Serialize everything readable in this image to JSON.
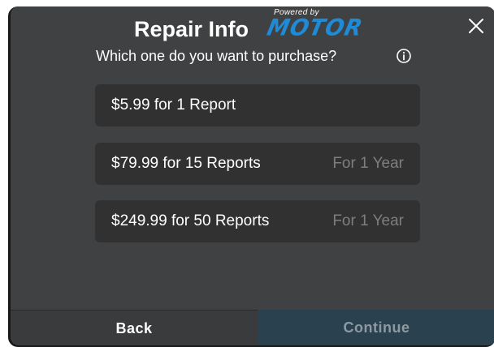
{
  "dialog": {
    "title": "Repair Info",
    "logo": {
      "powered_by": "Powered by",
      "brand": "MOTOR",
      "brand_color": "#1f8ad6"
    },
    "subtitle": "Which one do you want to purchase?",
    "close_icon": "close-icon",
    "info_icon": "info-icon"
  },
  "options": [
    {
      "label": "$5.99 for 1 Report",
      "term": ""
    },
    {
      "label": "$79.99 for 15 Reports",
      "term": "For 1 Year"
    },
    {
      "label": "$249.99 for 50 Reports",
      "term": "For 1 Year"
    }
  ],
  "footer": {
    "back_label": "Back",
    "continue_label": "Continue"
  },
  "colors": {
    "background": "#404142",
    "option_background": "#313131",
    "muted_text": "#7e7e7e",
    "continue_background": "#2a4150"
  }
}
